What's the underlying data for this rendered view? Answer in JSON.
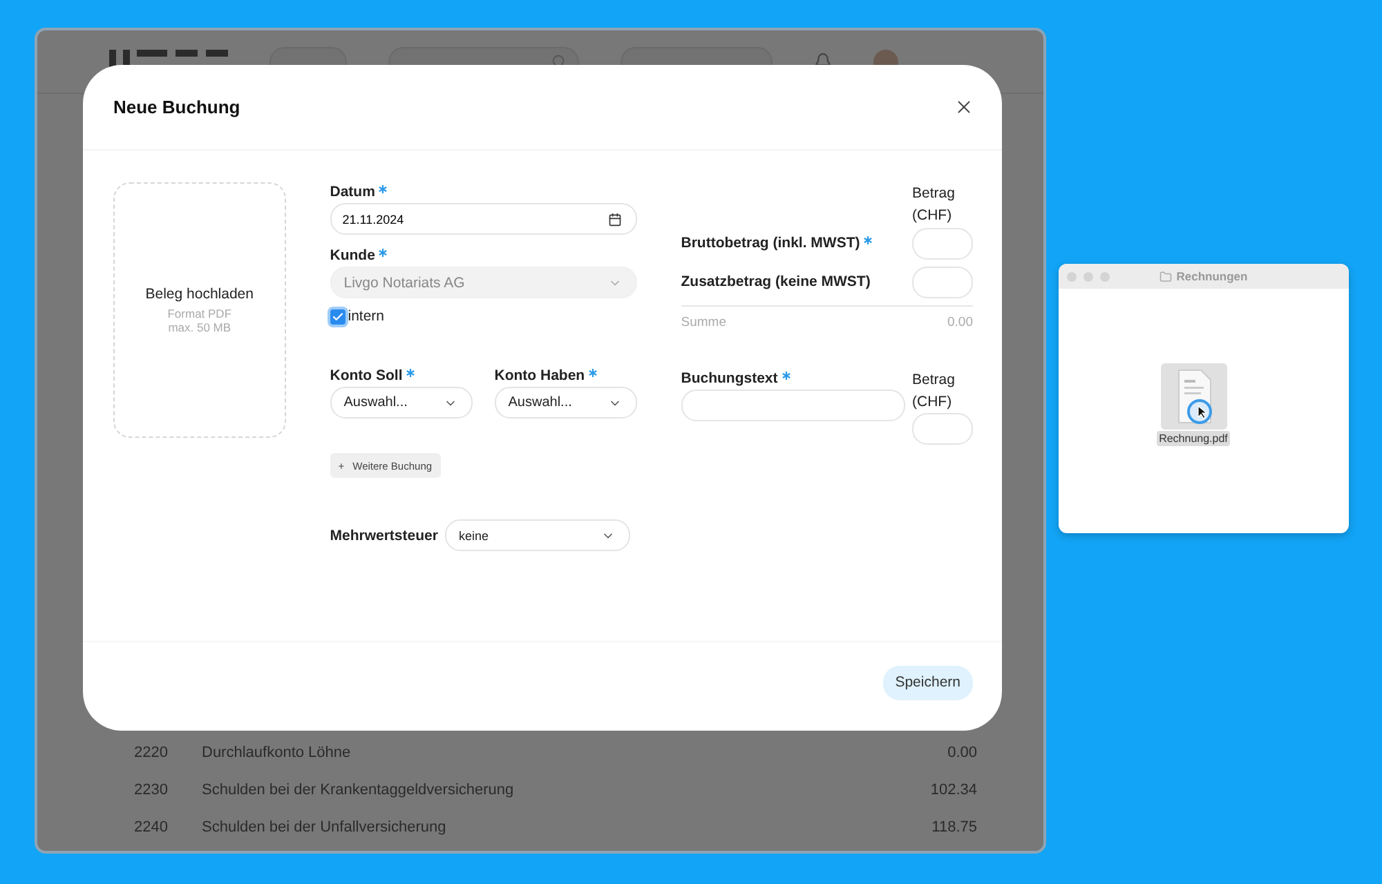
{
  "app": {
    "table": {
      "rows": [
        {
          "code": "2220",
          "name": "Durchlaufkonto Löhne",
          "amount": "0.00"
        },
        {
          "code": "2230",
          "name": "Schulden bei der Krankentaggeldversicherung",
          "amount": "102.34"
        },
        {
          "code": "2240",
          "name": "Schulden bei der Unfallversicherung",
          "amount": "118.75"
        }
      ]
    }
  },
  "dialog": {
    "title": "Neue Buchung",
    "upload": {
      "title": "Beleg hochladen",
      "format": "Format PDF",
      "max_size": "max. 50 MB"
    },
    "date": {
      "label": "Datum",
      "required": true,
      "value": "21.11.2024"
    },
    "customer": {
      "label": "Kunde",
      "required": true,
      "value": "Livgo Notariats AG",
      "disabled": true
    },
    "intern": {
      "label": "intern",
      "checked": true
    },
    "amounts": {
      "column_header": "Betrag (CHF)",
      "sum_label": "Summe",
      "sum_value": "0.00",
      "rows": [
        {
          "label": "Bruttobetrag (inkl. MWST)",
          "required": true
        },
        {
          "label": "Zusatzbetrag (keine MWST)",
          "required": false
        }
      ]
    },
    "booking": {
      "debit": {
        "label": "Konto Soll",
        "required": true,
        "value": "Auswahl..."
      },
      "credit": {
        "label": "Konto Haben",
        "required": true,
        "value": "Auswahl..."
      },
      "text": {
        "label": "Buchungstext",
        "required": true
      },
      "amount_header": "Betrag (CHF)"
    },
    "add_button": {
      "icon": "+",
      "label": "Weitere Buchung"
    },
    "vat": {
      "label": "Mehrwertsteuer",
      "value": "keine"
    },
    "save_button": "Speichern"
  },
  "finder": {
    "title": "Rechnungen",
    "file": "Rechnung.pdf"
  }
}
